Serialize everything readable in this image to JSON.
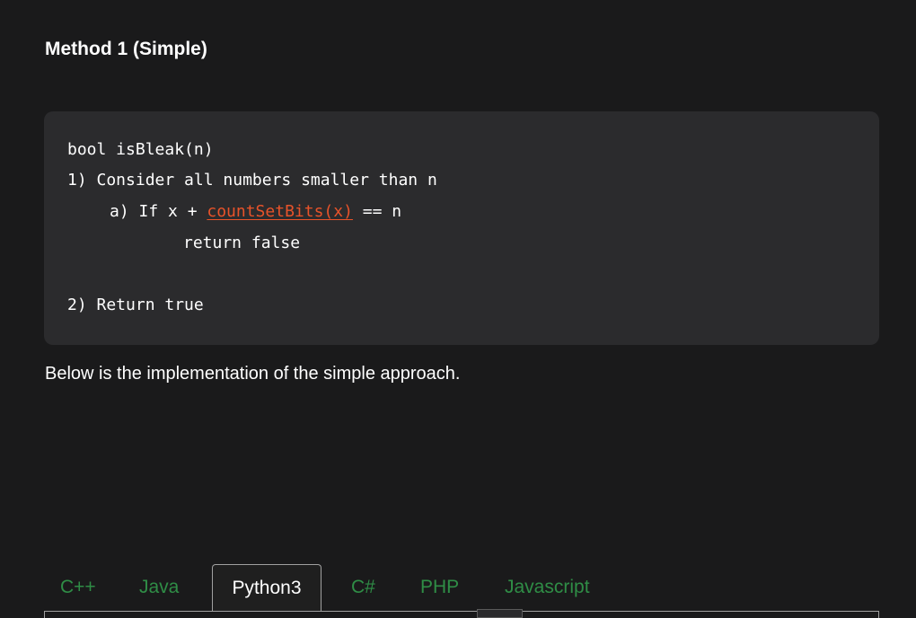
{
  "heading": "Method 1 (Simple)",
  "code": {
    "line1": "bool isBleak(n)",
    "line2": "1) Consider all numbers smaller than n",
    "line3_prefix": "a) If x + ",
    "line3_link": "countSetBits(x)",
    "line3_suffix": " == n",
    "line4": "return false",
    "line5": "2) Return true",
    "link_color": "#e8532a"
  },
  "paragraph": "Below is the implementation of the simple approach.",
  "tabs": [
    {
      "label": "C++",
      "active": false
    },
    {
      "label": "Java",
      "active": false
    },
    {
      "label": "Python3",
      "active": true
    },
    {
      "label": "C#",
      "active": false
    },
    {
      "label": "PHP",
      "active": false
    },
    {
      "label": "Javascript",
      "active": false
    }
  ],
  "colors": {
    "background": "#1a1a1b",
    "code_background": "#2b2b2d",
    "tab_inactive": "#2f8d46"
  }
}
